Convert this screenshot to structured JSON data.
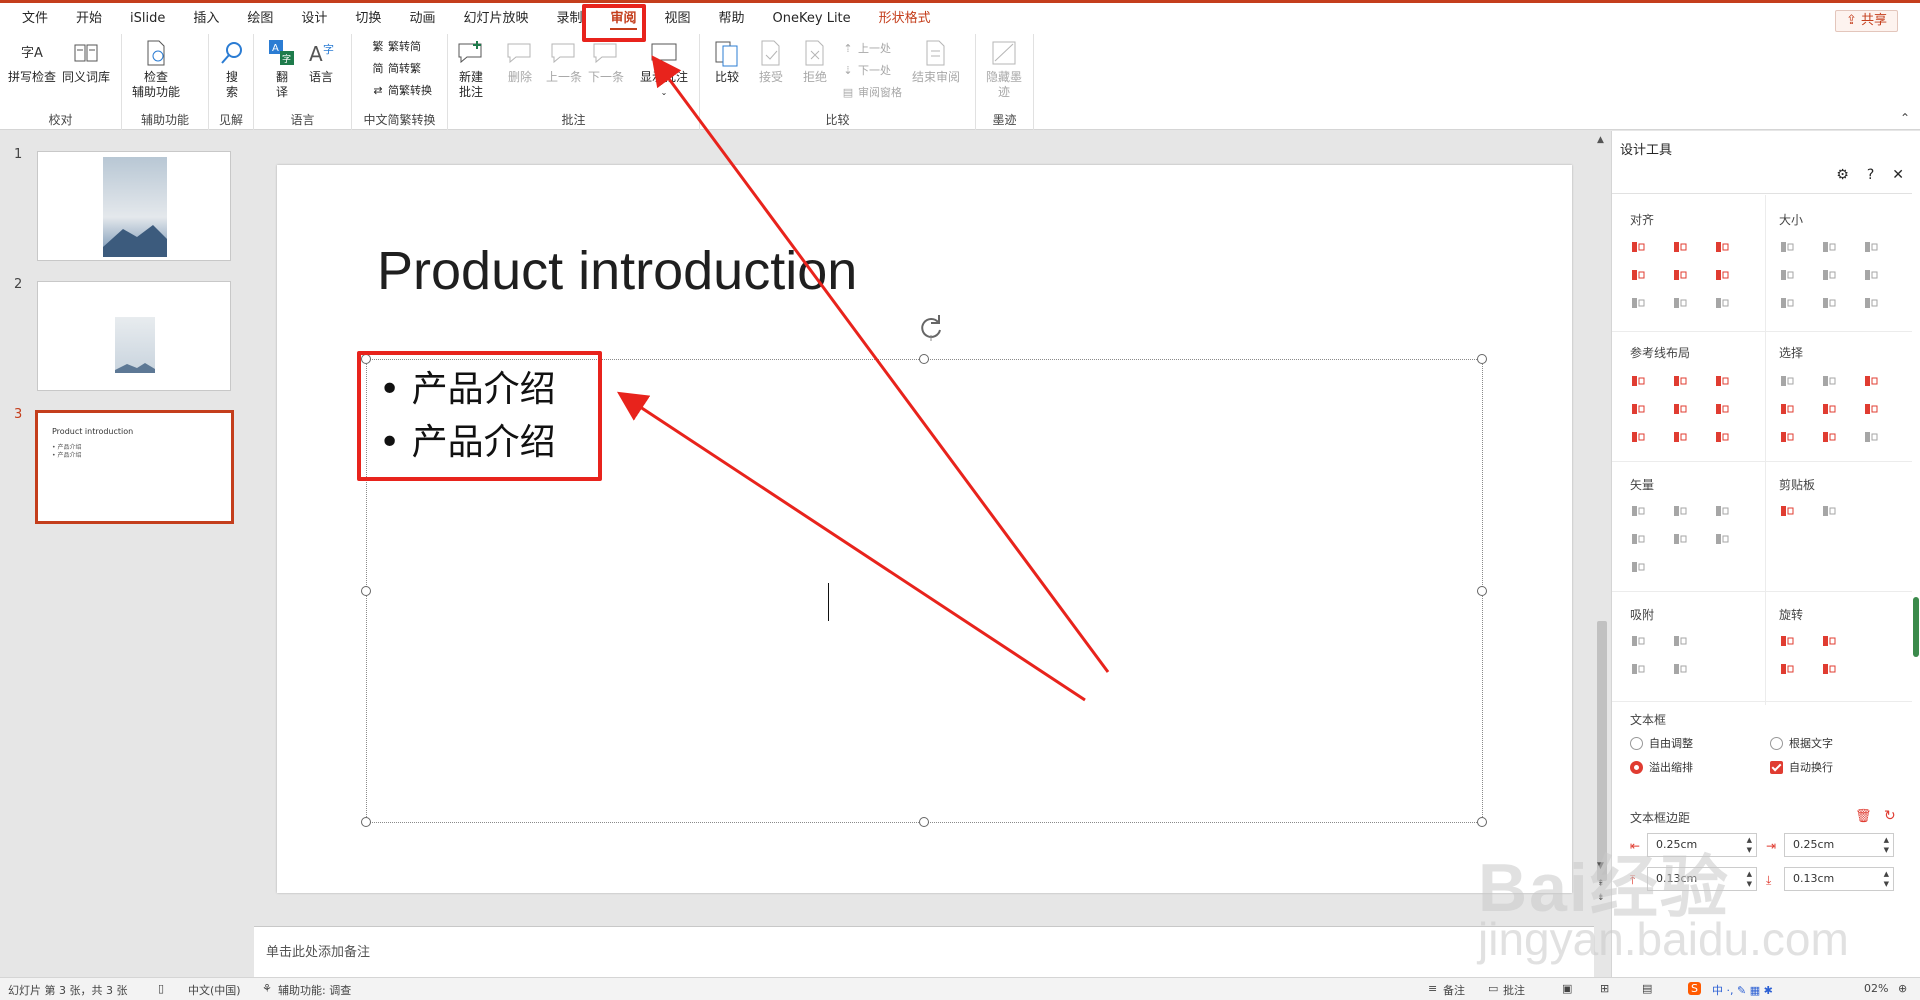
{
  "menu": {
    "items": [
      "文件",
      "开始",
      "iSlide",
      "插入",
      "绘图",
      "设计",
      "切换",
      "动画",
      "幻灯片放映",
      "录制",
      "审阅",
      "视图",
      "帮助",
      "OneKey Lite",
      "形状格式"
    ],
    "active": "审阅",
    "share_label": "共享"
  },
  "ribbon": {
    "spell_check": "拼写检查",
    "thesaurus": "同义词库",
    "group_proofing": "校对",
    "check_access": "检查",
    "check_access_2": "辅助功能",
    "group_access": "辅助功能",
    "search": "搜",
    "search_2": "索",
    "group_insights": "见解",
    "translate": "翻",
    "translate_2": "译",
    "language": "语言",
    "group_language": "语言",
    "trad_to_simp": "繁转简",
    "simp_to_trad": "简转繁",
    "conversion": "简繁转换",
    "group_chinese": "中文简繁转换",
    "new_comment": "新建",
    "new_comment_2": "批注",
    "delete": "删除",
    "prev_comment": "上一条",
    "next_comment": "下一条",
    "show_comments": "显示批注",
    "group_comments": "批注",
    "compare": "比较",
    "accept": "接受",
    "reject": "拒绝",
    "prev_change": "上一处",
    "next_change": "下一处",
    "review_pane": "审阅窗格",
    "end_review": "结束审阅",
    "group_compare": "比较",
    "hide_ink": "隐藏墨",
    "hide_ink_2": "迹",
    "group_ink": "墨迹",
    "spell_icon_text": "字A"
  },
  "slides": {
    "numbers": [
      "1",
      "2",
      "3"
    ],
    "thumb3_title": "Product introduction",
    "thumb3_bullet": "• 产品介绍"
  },
  "slide": {
    "title": "Product introduction",
    "bullets": [
      "• 产品介绍",
      "• 产品介绍"
    ]
  },
  "notes": {
    "placeholder": "单击此处添加备注"
  },
  "design_pane": {
    "title": "设计工具",
    "align": "对齐",
    "size": "大小",
    "guide_layout": "参考线布局",
    "select": "选择",
    "vector": "矢量",
    "clipboard": "剪贴板",
    "snap": "吸附",
    "rotate": "旋转",
    "textbox": "文本框",
    "free_adjust": "自由调整",
    "fit_text": "根据文字",
    "overflow_shrink": "溢出缩排",
    "auto_wrap": "自动换行",
    "margin": "文本框边距",
    "margin_left": "0.25cm",
    "margin_right": "0.25cm",
    "margin_top": "0.13cm",
    "margin_bottom": "0.13cm"
  },
  "status": {
    "slide_info": "幻灯片 第 3 张，共 3 张",
    "language": "中文(中国)",
    "accessibility": "辅助功能: 调查",
    "notes": "备注",
    "comments": "批注",
    "zoom": "02%"
  },
  "watermark": {
    "logo": "Bai经验",
    "url": "jingyan.baidu.com"
  },
  "colors": {
    "accent": "#c43e1c",
    "annotation": "#e8231c",
    "pane_icon": "#e03c31"
  }
}
